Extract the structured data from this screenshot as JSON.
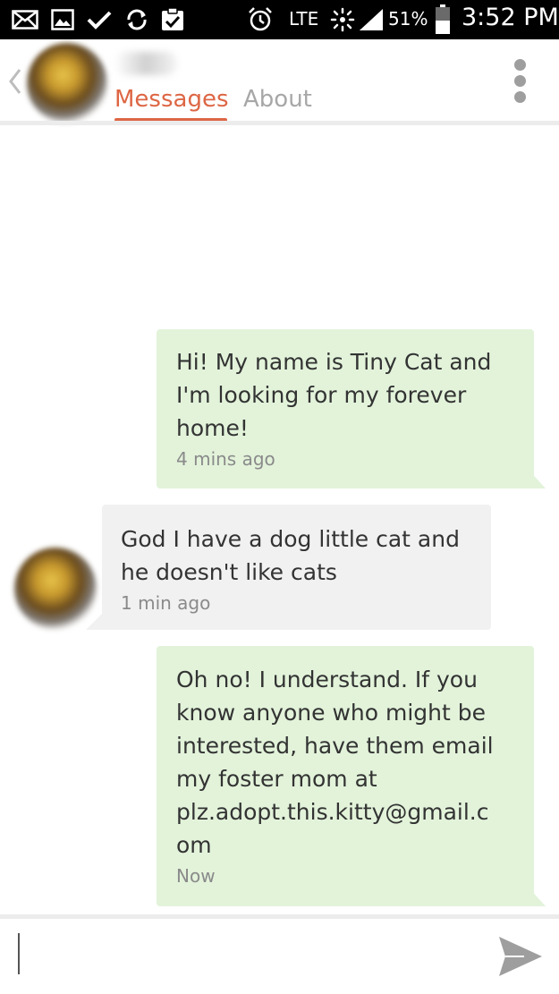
{
  "status_bar": {
    "lte_label": "LTE",
    "battery_percent": "51%",
    "time": "3:52 PM",
    "icons": [
      "email-icon",
      "gallery-icon",
      "check-icon",
      "sync-icon",
      "clipboard-check-icon",
      "alarm-icon",
      "hotspot-icon",
      "signal-icon",
      "battery-icon"
    ]
  },
  "header": {
    "tabs": [
      {
        "label": "Messages",
        "active": true
      },
      {
        "label": "About",
        "active": false
      }
    ],
    "accent_color": "#dd6644"
  },
  "messages": [
    {
      "direction": "sent",
      "text": "Hi! My name is Tiny Cat and\nI'm looking for my forever\nhome!",
      "time": "4 mins ago"
    },
    {
      "direction": "received",
      "text": "God I have a dog little cat and\nhe doesn't like cats",
      "time": "1 min ago"
    },
    {
      "direction": "sent",
      "text": "Oh no! I understand. If you\nknow anyone who might be\ninterested, have them email\nmy foster mom at\nplz.adopt.this.kitty@gmail.c\nom",
      "time": "Now"
    }
  ],
  "colors": {
    "sent_bubble": "#e2f3da",
    "received_bubble": "#f1f1f1"
  },
  "composer": {
    "placeholder": ""
  }
}
